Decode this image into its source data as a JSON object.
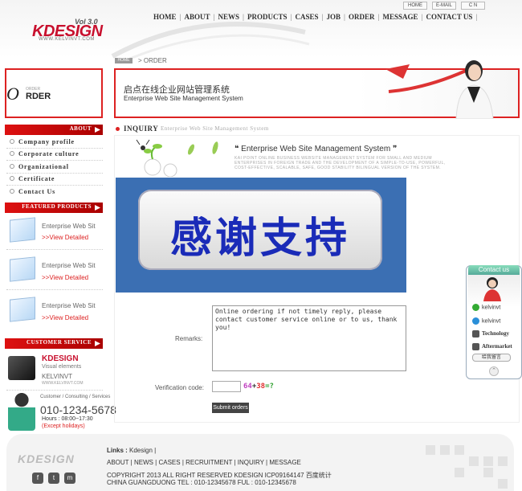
{
  "colors": {
    "accent": "#d22222",
    "overlay": "#3b6fb3",
    "overlay_text": "#1a2bb8"
  },
  "header": {
    "logo": "KDESIGN",
    "version": "Vol 3.0",
    "logo_url": "WWW.KELVINVT.COM",
    "top_buttons": [
      "HOME",
      "E-MAIL",
      "C N"
    ],
    "nav": [
      "HOME",
      "ABOUT",
      "NEWS",
      "PRODUCTS",
      "CASES",
      "JOB",
      "ORDER",
      "MESSAGE",
      "CONTACT US"
    ],
    "nav_sep": "|"
  },
  "breadcrumb": {
    "home": "HOME",
    "sep": ">",
    "current": "ORDER"
  },
  "left": {
    "order_letter": "O",
    "order_small": "ORDER",
    "order_rest": "RDER",
    "about_title": "ABOUT",
    "about_items": [
      "Company profile",
      "Corporate culture",
      "Organizational",
      "Certificate",
      "Contact Us"
    ],
    "products_title": "FEATURED PRODUCTS",
    "products": [
      {
        "title": "Enterprise Web Sit",
        "link": ">>View Detailed"
      },
      {
        "title": "Enterprise Web Sit",
        "link": ">>View Detailed"
      },
      {
        "title": "Enterprise Web Sit",
        "link": ">>View Detailed"
      }
    ],
    "service_title": "CUSTOMER SERVICE",
    "service": {
      "brand": "KDESIGN",
      "visual": "Visual elements",
      "kelvin": "KELVINVT",
      "url": "WWW.KELVINVT.COM",
      "consult": "Customer / Consulting / Services",
      "phone": "010-1234-5678",
      "hours": "Hours : 08:00~17:30",
      "except": "(Except holidays)"
    }
  },
  "banner": {
    "cn": "启点在线企业网站管理系统",
    "en": "Enterprise Web Site Management System"
  },
  "inquiry": {
    "title": "INQUIRY",
    "subtitle": "Enterprise Web Site Management System",
    "ews_title": "Enterprise Web Site Management System",
    "ews_desc": "KAI POINT ONLINE BUSINESS WEBSITE MANAGEMENT SYSTEM FOR SMALL AND MEDIUM ENTERPRISES IN FOREIGN TRADE AND THE DEVELOPMENT OF A SIMPLE-TO-USE, POWERFUL, COST-EFFECTIVE, SCALABLE, SAFE, GOOD STABILITY BILINGUAL VERSION OF THE SYSTEM.",
    "overlay_text": "感谢支持"
  },
  "form": {
    "remarks_label": "Remarks:",
    "remarks_value": "Online ordering if not timely reply, please contact customer service online or to us, thank you!",
    "verification_label": "Verification code:",
    "captcha": [
      {
        "ch": "64",
        "color": "#c040c0"
      },
      {
        "ch": "+",
        "color": "#333333"
      },
      {
        "ch": "38",
        "color": "#e03030"
      },
      {
        "ch": "=?",
        "color": "#30a030"
      }
    ],
    "submit": "Submit orders"
  },
  "contact_widget": {
    "title": "Contact us",
    "rows": [
      {
        "label": "kelvinvt",
        "icon": "chat-icon",
        "color": "#3a3"
      },
      {
        "label": "kelvinvt",
        "icon": "skype-icon",
        "color": "#2a8fd8"
      },
      {
        "label": "Technology",
        "icon": "phone-icon",
        "color": "#555"
      },
      {
        "label": "Aftermarket",
        "icon": "phone-icon",
        "color": "#555"
      }
    ],
    "message_btn": "给我留言"
  },
  "footer": {
    "logo": "KDESIGN",
    "links_label": "Links :",
    "links": "Kdesign",
    "nav": [
      "ABOUT",
      "NEWS",
      "CASES",
      "RECRUITMENT",
      "INQUIRY",
      "MESSAGE"
    ],
    "copyright": "COPYRIGHT 2013 ALL RIGHT RESERVED KDESIGN ICP09164147 百度统计",
    "address": "CHINA GUANGDUONG TEL : 010-12345678 FUL : 010-12345678",
    "social": [
      "f",
      "t",
      "m"
    ]
  }
}
